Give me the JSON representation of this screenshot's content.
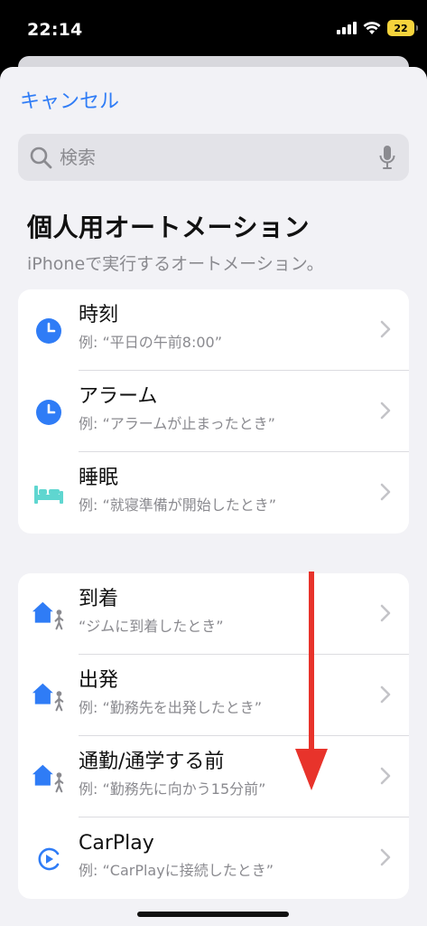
{
  "status": {
    "time": "22:14",
    "battery": "22"
  },
  "header": {
    "cancel_label": "キャンセル"
  },
  "search": {
    "placeholder": "検索"
  },
  "page": {
    "title": "個人用オートメーション",
    "subtitle": "iPhoneで実行するオートメーション。"
  },
  "groups": [
    {
      "items": [
        {
          "label": "時刻",
          "example": "例: “平日の午前8:00”",
          "icon": "clock-icon"
        },
        {
          "label": "アラーム",
          "example": "例: “アラームが止まったとき”",
          "icon": "clock-icon"
        },
        {
          "label": "睡眠",
          "example": "例: “就寝準備が開始したとき”",
          "icon": "bed-icon"
        }
      ]
    },
    {
      "items": [
        {
          "label": "到着",
          "example": "“ジムに到着したとき”",
          "icon": "home-person-icon"
        },
        {
          "label": "出発",
          "example": "例: “勤務先を出発したとき”",
          "icon": "home-person-icon"
        },
        {
          "label": "通勤/通学する前",
          "example": "例: “勤務先に向かう15分前”",
          "icon": "home-person-icon"
        },
        {
          "label": "CarPlay",
          "example": "例: “CarPlayに接続したとき”",
          "icon": "carplay-icon"
        }
      ]
    }
  ],
  "colors": {
    "accent": "#2f7cf6",
    "sleep": "#5fd6d0",
    "arrow": "#e8332b"
  }
}
